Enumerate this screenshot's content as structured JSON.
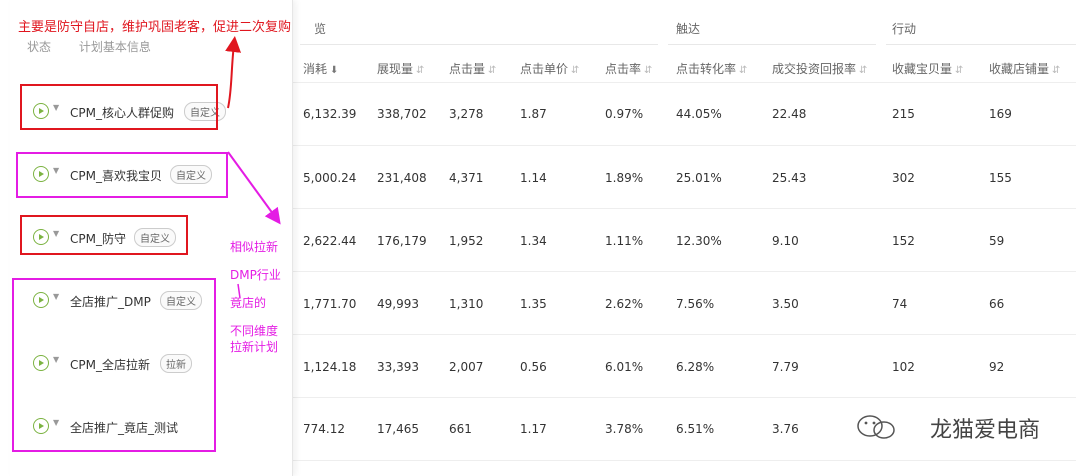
{
  "left": {
    "header": {
      "status": "状态",
      "info": "计划基本信息"
    },
    "plans": [
      {
        "name": "CPM_核心人群促购",
        "tag": "自定义"
      },
      {
        "name": "CPM_喜欢我宝贝",
        "tag": "自定义"
      },
      {
        "name": "CPM_防守",
        "tag": "自定义"
      },
      {
        "name": "全店推广_DMP",
        "tag": "自定义"
      },
      {
        "name": "CPM_全店拉新",
        "tag": "拉新"
      },
      {
        "name": "全店推广_竟店_测试",
        "tag": ""
      }
    ]
  },
  "groups": {
    "overview": "览",
    "reach": "触达",
    "action": "行动"
  },
  "columns": {
    "cost": "消耗",
    "impressions": "展现量",
    "clicks": "点击量",
    "cpc": "点击单价",
    "ctr": "点击率",
    "cvr": "点击转化率",
    "roi": "成交投资回报率",
    "fav_items": "收藏宝贝量",
    "fav_shop": "收藏店铺量"
  },
  "rows": [
    [
      "6,132.39",
      "338,702",
      "3,278",
      "1.87",
      "0.97%",
      "44.05%",
      "22.48",
      "215",
      "169"
    ],
    [
      "5,000.24",
      "231,408",
      "4,371",
      "1.14",
      "1.89%",
      "25.01%",
      "25.43",
      "302",
      "155"
    ],
    [
      "2,622.44",
      "176,179",
      "1,952",
      "1.34",
      "1.11%",
      "12.30%",
      "9.10",
      "152",
      "59"
    ],
    [
      "1,771.70",
      "49,993",
      "1,310",
      "1.35",
      "2.62%",
      "7.56%",
      "3.50",
      "74",
      "66"
    ],
    [
      "1,124.18",
      "33,393",
      "2,007",
      "0.56",
      "6.01%",
      "6.28%",
      "7.79",
      "102",
      "92"
    ],
    [
      "774.12",
      "17,465",
      "661",
      "1.17",
      "3.78%",
      "6.51%",
      "3.76",
      "",
      ""
    ]
  ],
  "annotations": {
    "top_note": "主要是防守自店，维护巩固老客，促进二次复购",
    "side_note_1": "相似拉新",
    "side_note_2": "DMP行业",
    "side_note_3": "竟店的",
    "side_note_4": "不同维度",
    "side_note_5": "拉新计划"
  },
  "watermark": "龙猫爱电商",
  "colors": {
    "annotation_red": "#e0161f",
    "annotation_pink": "#e41ce4",
    "play_green": "#7cb342",
    "tab_blue": "#2e8ae6"
  }
}
